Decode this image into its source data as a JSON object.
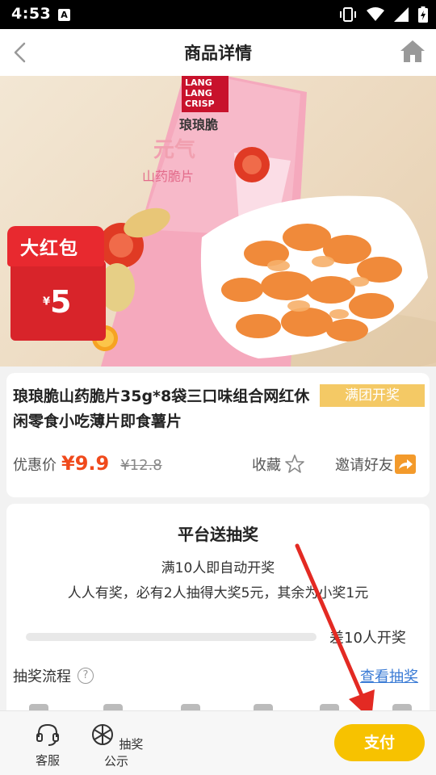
{
  "status_bar": {
    "time": "4:53",
    "notif_badge": "A"
  },
  "nav": {
    "title": "商品详情",
    "back_icon": "chevron-left-icon",
    "home_icon": "home-icon"
  },
  "hero": {
    "package_brand": "LANG LANG CRISP",
    "package_cn_brand": "琅琅脆",
    "package_flavor": "元气",
    "package_sub": "山药脆片"
  },
  "red_envelope": {
    "label": "大红包",
    "currency": "¥",
    "amount": "5"
  },
  "product": {
    "name": "琅琅脆山药脆片35g*8袋三口味组合网红休闲零食小吃薄片即食薯片",
    "tag": "满团开奖",
    "price_label": "优惠价",
    "price": "¥9.9",
    "original_price": "¥12.8",
    "favorite_label": "收藏",
    "invite_label": "邀请好友"
  },
  "lottery": {
    "title": "平台送抽奖",
    "line1": "满10人即自动开奖",
    "line2": "人人有奖，必有2人抽得大奖5元，其余为小奖1元",
    "progress": 0,
    "remaining_text": "差10人开奖",
    "flow_label": "抽奖流程",
    "help_glyph": "?",
    "view_link": "查看抽奖"
  },
  "bottom_bar": {
    "service_label": "客服",
    "lottery_label": "抽奖公示",
    "pay_label": "支付"
  },
  "colors": {
    "accent": "#f7c200",
    "price_red": "#f04a1c",
    "tag_yellow": "#f4c965",
    "link_blue": "#3a7bd5",
    "envelope_red": "#e8292f"
  }
}
